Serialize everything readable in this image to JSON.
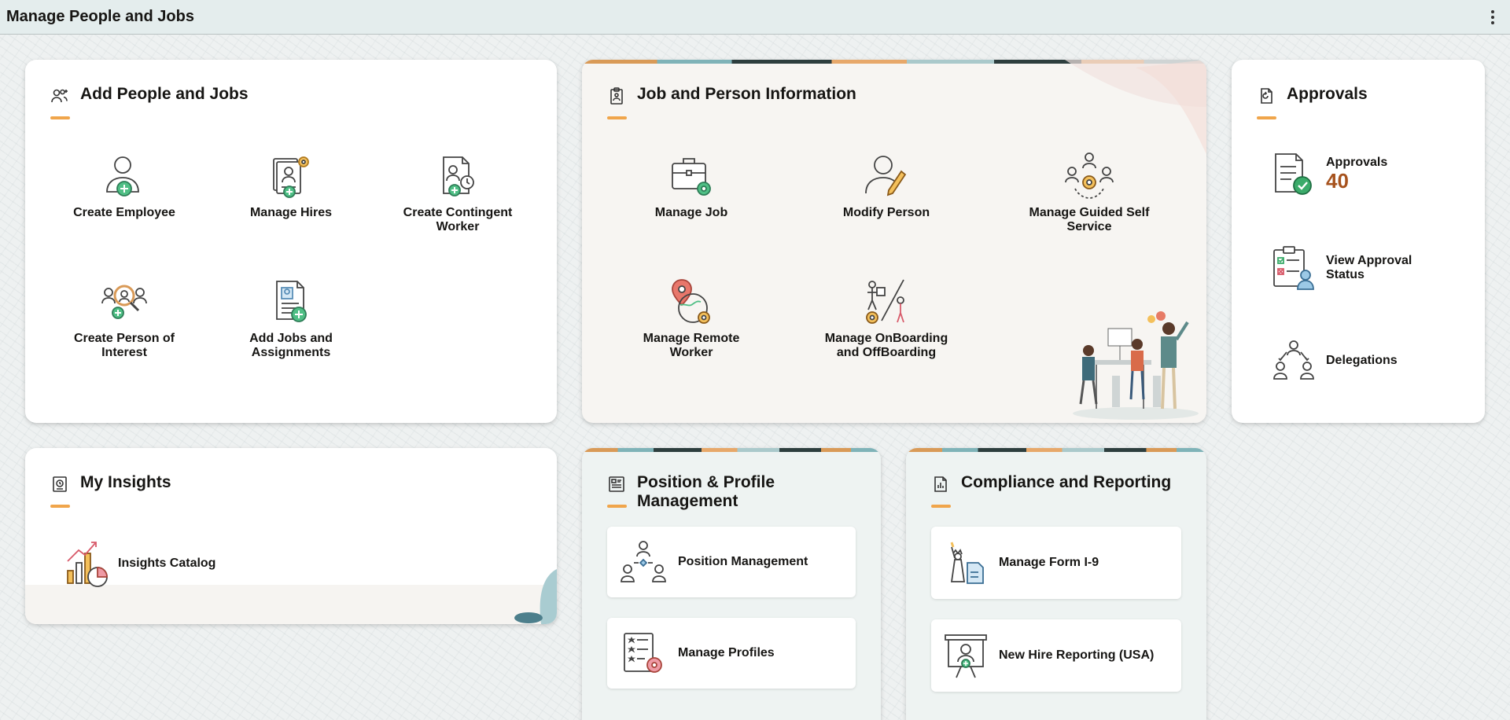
{
  "page": {
    "title": "Manage People and Jobs",
    "menu_icon": "kebab-menu-icon"
  },
  "add_people": {
    "title": "Add People and Jobs",
    "tiles": [
      {
        "label": "Create Employee",
        "icon": "create-employee-icon"
      },
      {
        "label": "Manage Hires",
        "icon": "manage-hires-icon"
      },
      {
        "label": "Create Contingent Worker",
        "icon": "contingent-worker-icon"
      },
      {
        "label": "Create Person of Interest",
        "icon": "person-of-interest-icon"
      },
      {
        "label": "Add Jobs and Assignments",
        "icon": "add-jobs-icon"
      }
    ]
  },
  "job_person": {
    "title": "Job and Person Information",
    "tiles": [
      {
        "label": "Manage Job",
        "icon": "briefcase-gear-icon"
      },
      {
        "label": "Modify Person",
        "icon": "person-pencil-icon"
      },
      {
        "label": "Manage Guided Self Service",
        "icon": "guided-self-service-icon"
      },
      {
        "label": "Manage Remote Worker",
        "icon": "remote-worker-icon"
      },
      {
        "label": "Manage OnBoarding and OffBoarding",
        "icon": "onboarding-icon"
      }
    ]
  },
  "approvals": {
    "title": "Approvals",
    "items": [
      {
        "label": "Approvals",
        "count": "40",
        "icon": "approvals-document-icon"
      },
      {
        "label": "View Approval Status",
        "icon": "approval-status-icon"
      },
      {
        "label": "Delegations",
        "icon": "delegations-icon"
      }
    ]
  },
  "insights": {
    "title": "My Insights",
    "items": [
      {
        "label": "Insights Catalog",
        "icon": "insights-chart-icon"
      }
    ]
  },
  "position": {
    "title": "Position & Profile Management",
    "items": [
      {
        "label": "Position Management",
        "icon": "org-chart-icon"
      },
      {
        "label": "Manage Profiles",
        "icon": "profile-checklist-icon"
      }
    ]
  },
  "compliance": {
    "title": "Compliance and Reporting",
    "items": [
      {
        "label": "Manage Form I-9",
        "icon": "statue-liberty-form-icon"
      },
      {
        "label": "New Hire Reporting (USA)",
        "icon": "new-hire-board-icon"
      }
    ]
  },
  "colors": {
    "accent": "#f0a54b",
    "count": "#a6521d",
    "check_green": "#3bab6a"
  }
}
